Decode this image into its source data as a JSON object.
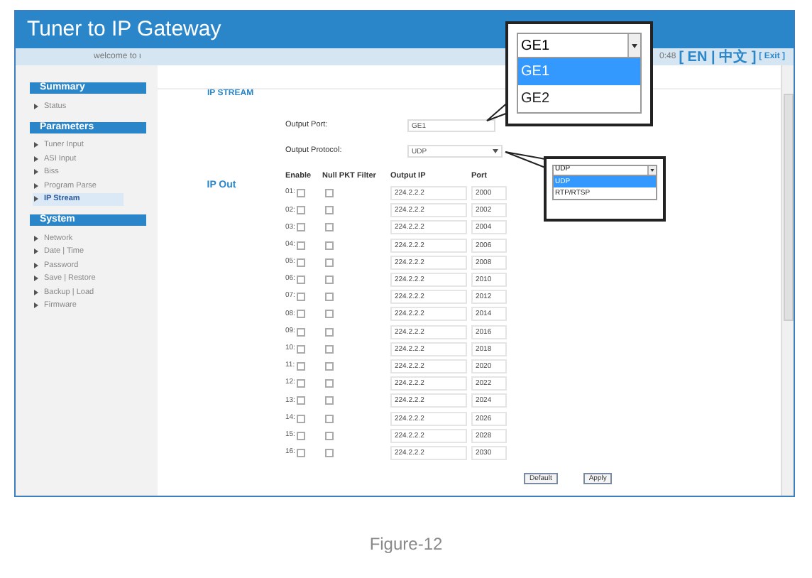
{
  "header": {
    "title": "Tuner to IP Gateway"
  },
  "subbar": {
    "welcome": "welcome to ι",
    "time": "0:48",
    "language": "[ EN | 中文 ]",
    "exit": "[ Exit ]"
  },
  "sidebar": {
    "sections": [
      {
        "title": "Summary",
        "items": [
          {
            "label": "Status",
            "selected": false
          }
        ]
      },
      {
        "title": "Parameters",
        "items": [
          {
            "label": "Tuner Input",
            "selected": false
          },
          {
            "label": "ASI Input",
            "selected": false
          },
          {
            "label": "Biss",
            "selected": false
          },
          {
            "label": "Program Parse",
            "selected": false
          },
          {
            "label": "IP Stream",
            "selected": true
          }
        ]
      },
      {
        "title": "System",
        "items": [
          {
            "label": "Network",
            "selected": false
          },
          {
            "label": "Date | Time",
            "selected": false
          },
          {
            "label": "Password",
            "selected": false
          },
          {
            "label": "Save | Restore",
            "selected": false
          },
          {
            "label": "Backup | Load",
            "selected": false
          },
          {
            "label": "Firmware",
            "selected": false
          }
        ]
      }
    ]
  },
  "content": {
    "title": "IP STREAM",
    "section_label": "IP Out",
    "output_port": {
      "label": "Output Port:",
      "value": "GE1"
    },
    "output_protocol": {
      "label": "Output Protocol:",
      "value": "UDP"
    },
    "table": {
      "columns": [
        "Enable",
        "Null PKT Filter",
        "Output IP",
        "Port"
      ],
      "rows": [
        {
          "index": "01:",
          "enable": false,
          "null_pkt_filter": false,
          "output_ip": "224.2.2.2",
          "port": "2000"
        },
        {
          "index": "02:",
          "enable": false,
          "null_pkt_filter": false,
          "output_ip": "224.2.2.2",
          "port": "2002"
        },
        {
          "index": "03:",
          "enable": false,
          "null_pkt_filter": false,
          "output_ip": "224.2.2.2",
          "port": "2004"
        },
        {
          "index": "04:",
          "enable": false,
          "null_pkt_filter": false,
          "output_ip": "224.2.2.2",
          "port": "2006"
        },
        {
          "index": "05:",
          "enable": false,
          "null_pkt_filter": false,
          "output_ip": "224.2.2.2",
          "port": "2008"
        },
        {
          "index": "06:",
          "enable": false,
          "null_pkt_filter": false,
          "output_ip": "224.2.2.2",
          "port": "2010"
        },
        {
          "index": "07:",
          "enable": false,
          "null_pkt_filter": false,
          "output_ip": "224.2.2.2",
          "port": "2012"
        },
        {
          "index": "08:",
          "enable": false,
          "null_pkt_filter": false,
          "output_ip": "224.2.2.2",
          "port": "2014"
        },
        {
          "index": "09:",
          "enable": false,
          "null_pkt_filter": false,
          "output_ip": "224.2.2.2",
          "port": "2016"
        },
        {
          "index": "10:",
          "enable": false,
          "null_pkt_filter": false,
          "output_ip": "224.2.2.2",
          "port": "2018"
        },
        {
          "index": "11:",
          "enable": false,
          "null_pkt_filter": false,
          "output_ip": "224.2.2.2",
          "port": "2020"
        },
        {
          "index": "12:",
          "enable": false,
          "null_pkt_filter": false,
          "output_ip": "224.2.2.2",
          "port": "2022"
        },
        {
          "index": "13:",
          "enable": false,
          "null_pkt_filter": false,
          "output_ip": "224.2.2.2",
          "port": "2024"
        },
        {
          "index": "14:",
          "enable": false,
          "null_pkt_filter": false,
          "output_ip": "224.2.2.2",
          "port": "2026"
        },
        {
          "index": "15:",
          "enable": false,
          "null_pkt_filter": false,
          "output_ip": "224.2.2.2",
          "port": "2028"
        },
        {
          "index": "16:",
          "enable": false,
          "null_pkt_filter": false,
          "output_ip": "224.2.2.2",
          "port": "2030"
        }
      ]
    },
    "buttons": [
      "Default",
      "Apply"
    ]
  },
  "callouts": [
    {
      "value": "GE1",
      "options": [
        {
          "label": "GE1",
          "selected": true
        },
        {
          "label": "GE2",
          "selected": false
        }
      ]
    },
    {
      "value": "UDP",
      "options": [
        {
          "label": "UDP",
          "selected": true
        },
        {
          "label": "RTP/RTSP",
          "selected": false
        }
      ]
    }
  ],
  "caption": "Figure-12"
}
